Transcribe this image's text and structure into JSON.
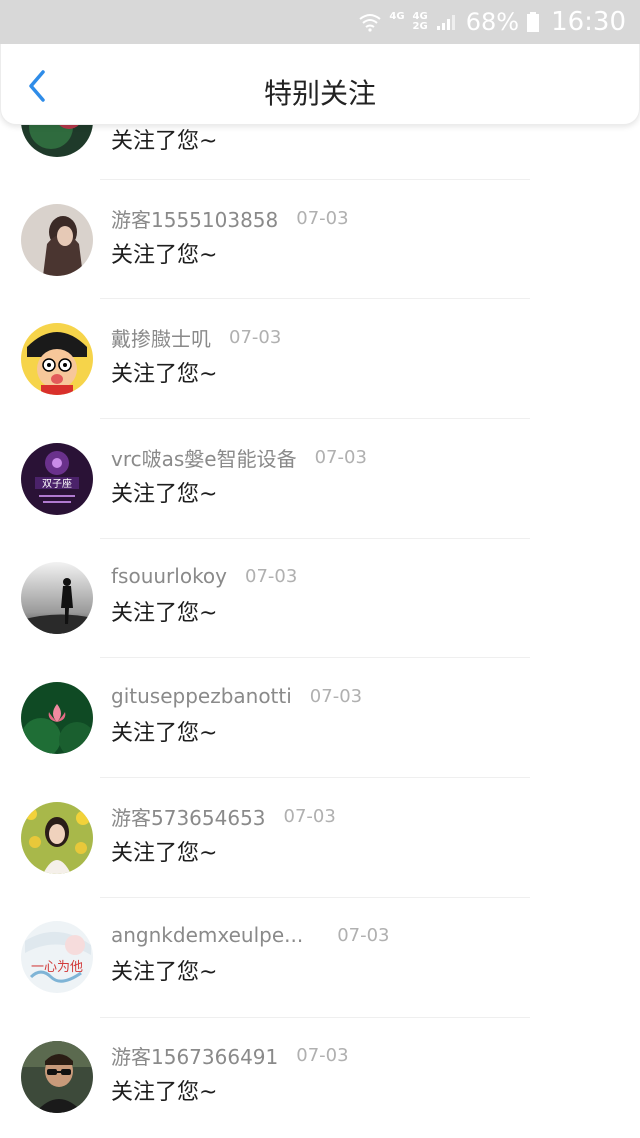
{
  "status_bar": {
    "network_top": "4G",
    "network_stack_top": "4G",
    "network_stack_bottom": "2G",
    "battery": "68%",
    "time": "16:30"
  },
  "nav": {
    "title": "特别关注",
    "back_icon": "chevron-left-icon",
    "accent_color": "#2f8ce8"
  },
  "list": {
    "partial_first_message": "关注了您~",
    "items": [
      {
        "name": "游客1555103858",
        "date": "07-03",
        "message": "关注了您~",
        "avatar": "girl-photo-avatar"
      },
      {
        "name": "戴掺臌士叽",
        "date": "07-03",
        "message": "关注了您~",
        "avatar": "cartoon-avatar"
      },
      {
        "name": "vrc啵as媻e智能设备",
        "date": "07-03",
        "message": "关注了您~",
        "avatar": "gemini-avatar"
      },
      {
        "name": "fsouurlokoy",
        "date": "07-03",
        "message": "关注了您~",
        "avatar": "silhouette-avatar"
      },
      {
        "name": "gituseppezbanotti",
        "date": "07-03",
        "message": "关注了您~",
        "avatar": "lotus-avatar"
      },
      {
        "name": "游客573654653",
        "date": "07-03",
        "message": "关注了您~",
        "avatar": "flower-girl-avatar"
      },
      {
        "name": "angnkdemxeulpe...",
        "date": "07-03",
        "message": "关注了您~",
        "avatar": "heart-text-avatar"
      },
      {
        "name": "游客1567366491",
        "date": "07-03",
        "message": "关注了您~",
        "avatar": "sunglasses-man-avatar"
      }
    ],
    "avatar_text": {
      "gemini": "双子座",
      "heart": "一心为他"
    }
  }
}
